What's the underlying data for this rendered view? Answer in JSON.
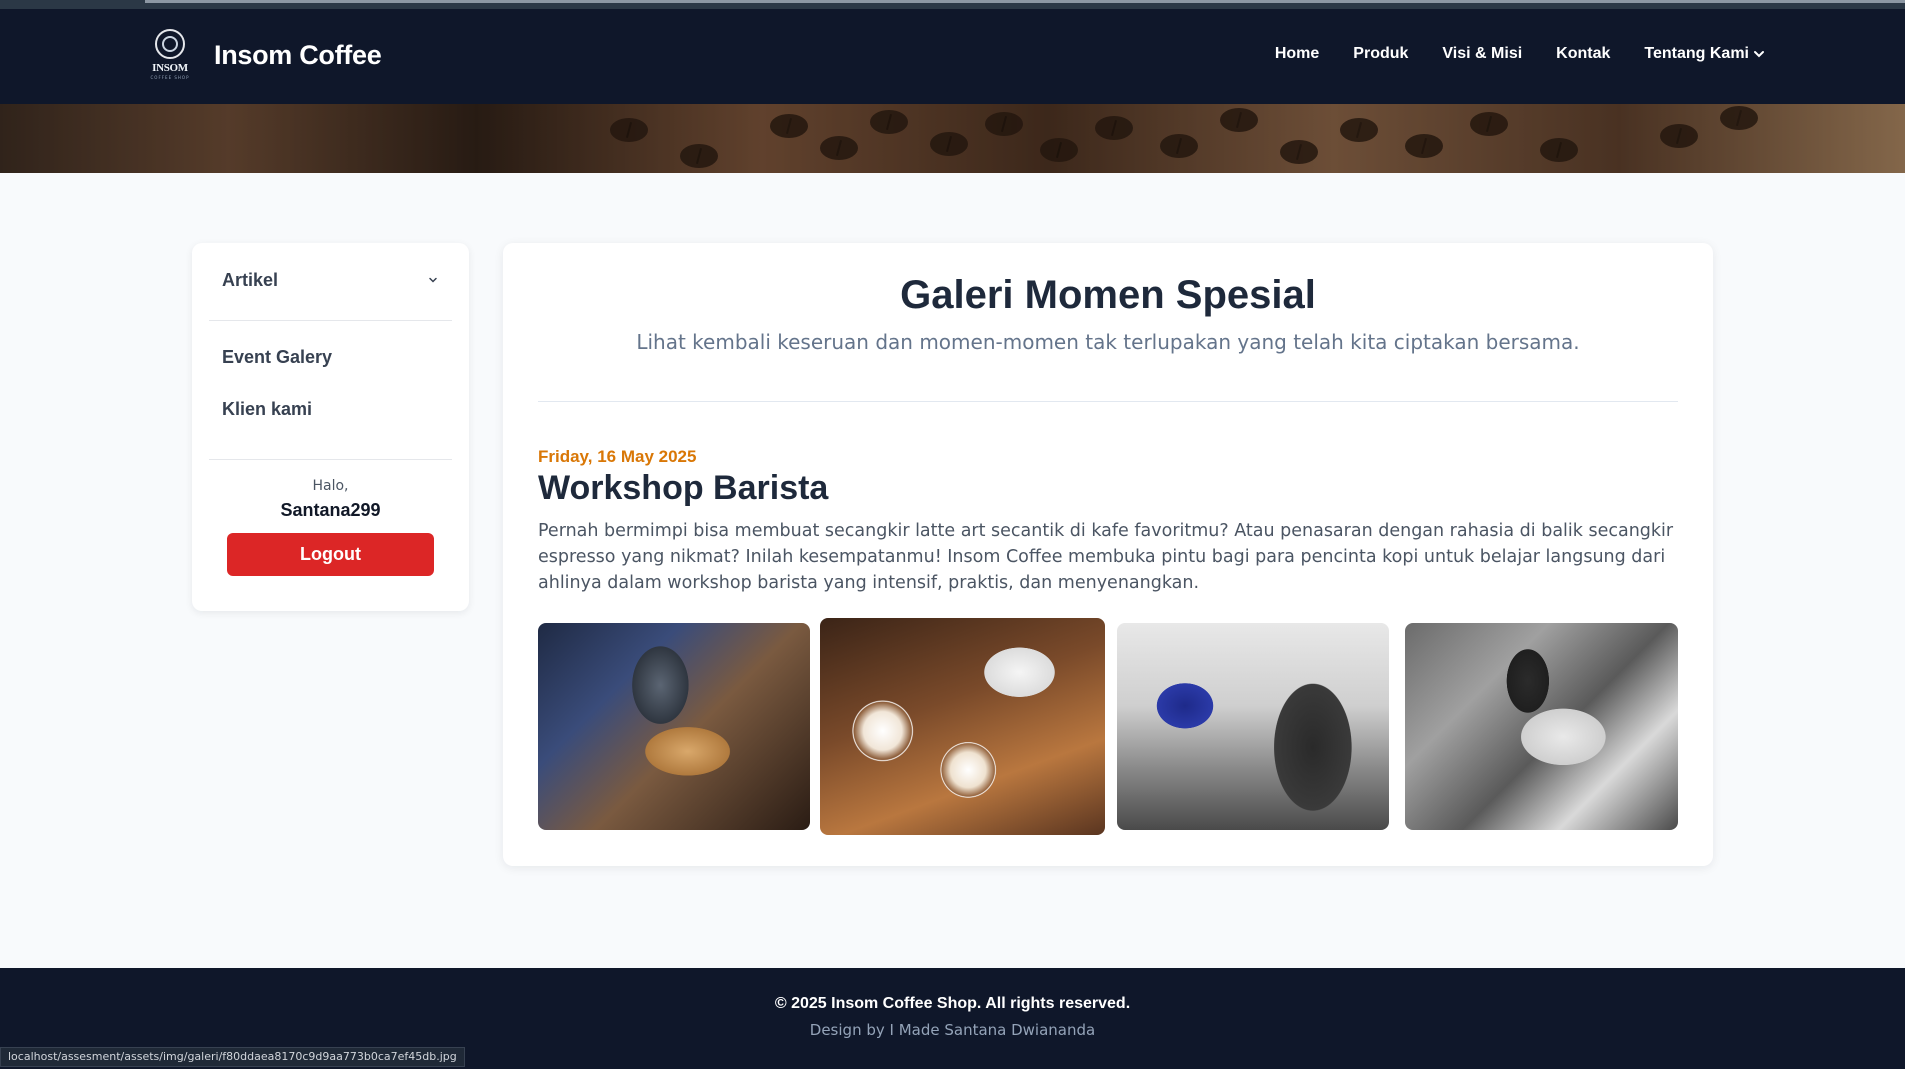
{
  "brand": {
    "logo_text": "INSOM",
    "logo_sub": "COFFEE SHOP",
    "name": "Insom Coffee"
  },
  "nav": {
    "items": [
      {
        "label": "Home"
      },
      {
        "label": "Produk"
      },
      {
        "label": "Visi & Misi"
      },
      {
        "label": "Kontak"
      },
      {
        "label": "Tentang Kami"
      }
    ]
  },
  "sidebar": {
    "section_label": "Artikel",
    "items": [
      {
        "label": "Event Galery"
      },
      {
        "label": "Klien kami"
      }
    ],
    "greeting": "Halo,",
    "username": "Santana299",
    "logout_label": "Logout"
  },
  "main": {
    "title": "Galeri Momen Spesial",
    "subtitle": "Lihat kembali keseruan dan momen-momen tak terlupakan yang telah kita ciptakan bersama.",
    "event": {
      "date": "Friday, 16 May 2025",
      "title": "Workshop Barista",
      "description": "Pernah bermimpi bisa membuat secangkir latte art secantik di kafe favoritmu? Atau penasaran dengan rahasia di balik secangkir espresso yang nikmat? Inilah kesempatanmu! Insom Coffee membuka pintu bagi para pencinta kopi untuk belajar langsung dari ahlinya dalam workshop barista yang intensif, praktis, dan menyenangkan."
    }
  },
  "footer": {
    "copyright": "© 2025 Insom Coffee Shop. All rights reserved.",
    "design_credit": "Design by I Made Santana Dwiananda"
  },
  "status_url": "localhost/assesment/assets/img/galeri/f80ddaea8170c9d9aa773b0ca7ef45db.jpg",
  "colors": {
    "nav_bg": "#0f172a",
    "accent_date": "#d97706",
    "logout": "#dc2626"
  }
}
